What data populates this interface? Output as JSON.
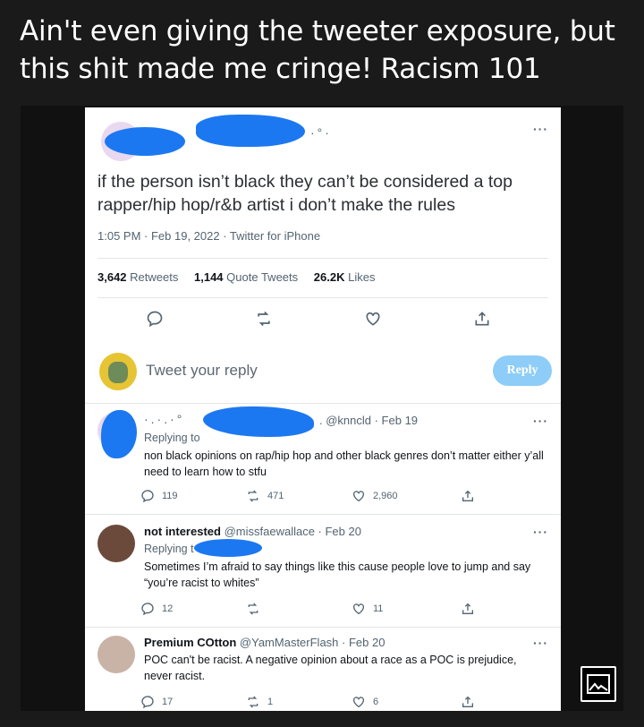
{
  "caption": "Ain't even giving the tweeter exposure, but this shit made me cringe! Racism 101",
  "main_tweet": {
    "text": "if the person isn’t black they can’t be considered a top rapper/hip hop/r&b artist i don’t make the rules",
    "meta": "1:05 PM · Feb 19, 2022 · Twitter for iPhone",
    "retweets_count": "3,642",
    "retweets_label": "Retweets",
    "quotes_count": "1,144",
    "quotes_label": "Quote Tweets",
    "likes_count": "26.2K",
    "likes_label": "Likes",
    "more": "···"
  },
  "reply_box": {
    "placeholder": "Tweet your reply",
    "button": "Reply"
  },
  "replies": [
    {
      "handle_date": ". @knncld · Feb 19",
      "replying_to": "Replying to",
      "text": "non black opinions on rap/hip hop and other black genres don’t matter either y’all need to learn how to stfu",
      "replies": "119",
      "retweets": "471",
      "likes": "2,960"
    },
    {
      "name": "not interested",
      "handle_date": "@missfaewallace · Feb 20",
      "replying_to": "Replying t",
      "text": "Sometimes I’m afraid to say things like this cause people love to jump and say “you’re racist to whites”",
      "replies": "12",
      "retweets": "",
      "likes": "11"
    },
    {
      "name": "Premium COtton",
      "handle_date": "@YamMasterFlash · Feb 20",
      "text": "POC can't be racist. A negative opinion about a race as a POC is prejudice, never racist.",
      "replies": "17",
      "retweets": "1",
      "likes": "6"
    }
  ],
  "colors": {
    "background": "#1a1a1a",
    "redaction": "#1c78f0",
    "reply_button": "#8ecdf8",
    "muted_text": "#536471"
  },
  "icons": [
    "reply-icon",
    "retweet-icon",
    "like-icon",
    "share-icon",
    "image-gallery-icon"
  ]
}
